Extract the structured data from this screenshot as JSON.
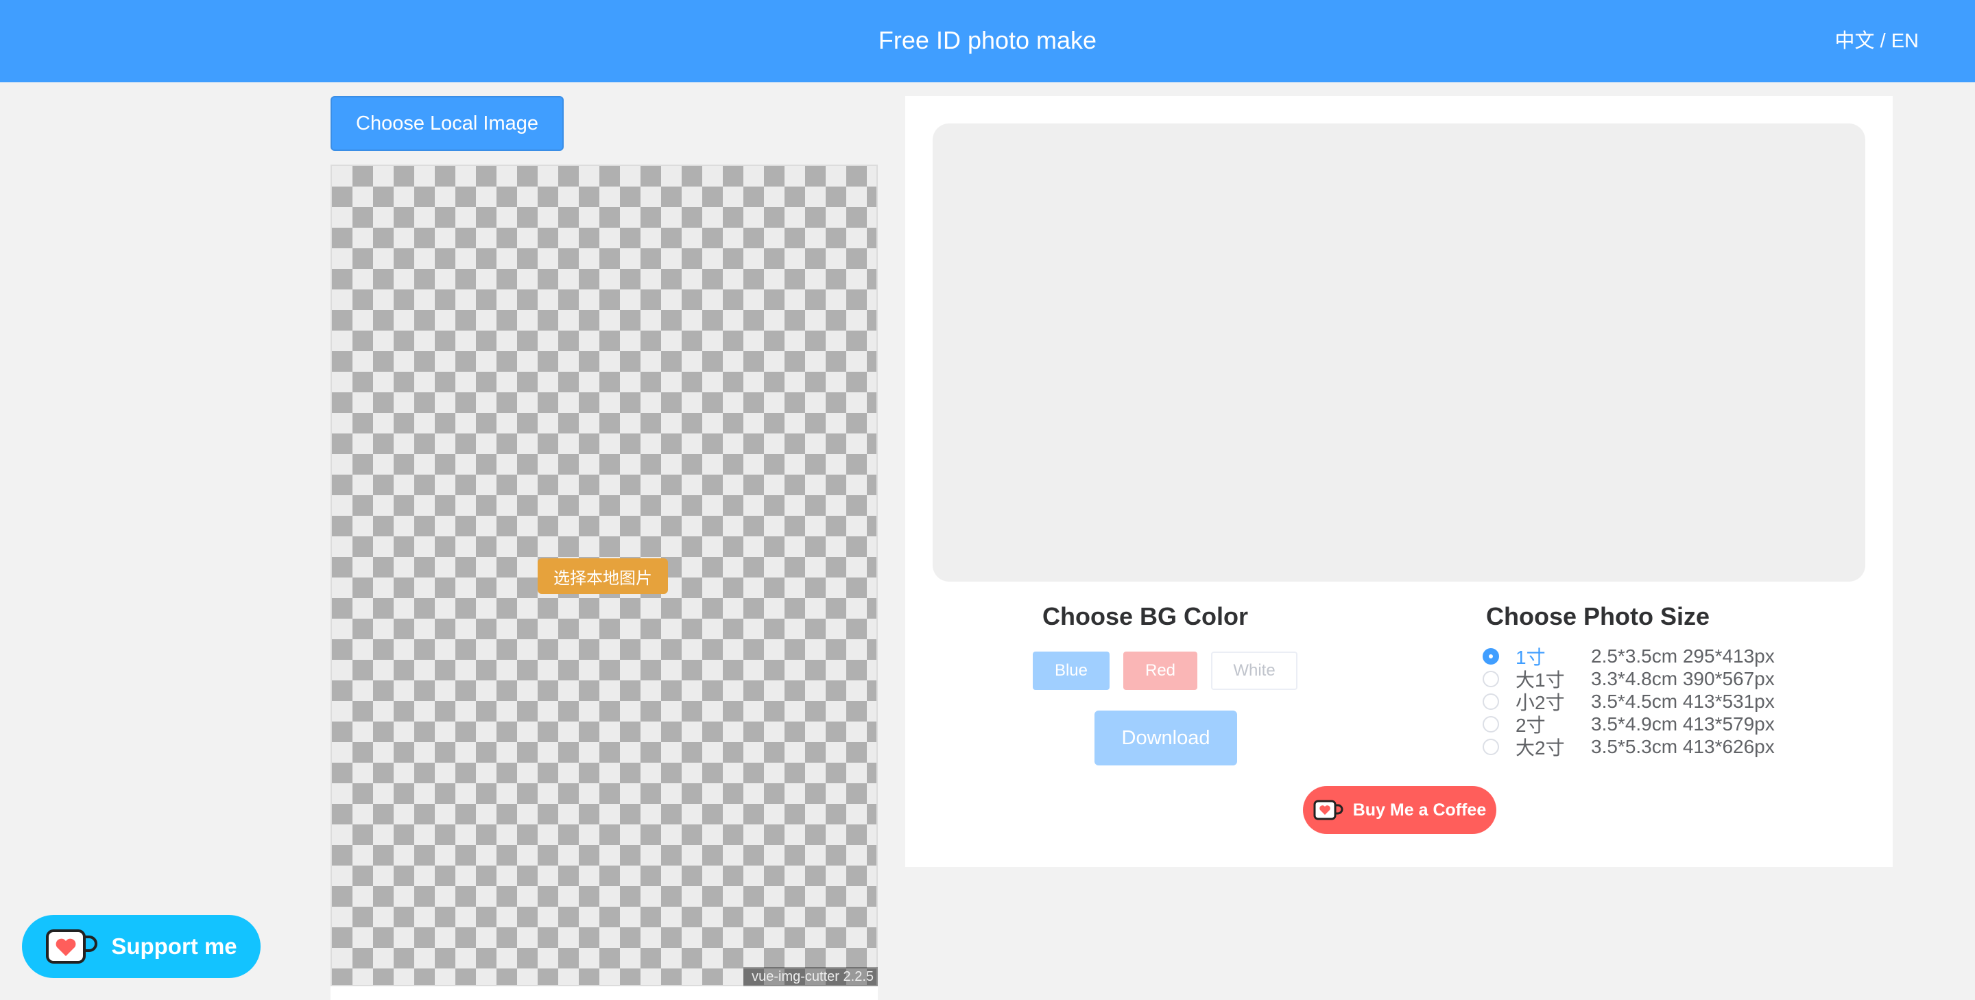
{
  "header": {
    "title": "Free ID photo make",
    "lang_switch": "中文 / EN"
  },
  "left": {
    "choose_button": "Choose Local Image",
    "cutter_select_button": "选择本地图片",
    "cutter_version": "vue-img-cutter 2.2.5"
  },
  "bg_color": {
    "title": "Choose BG Color",
    "options": [
      "Blue",
      "Red",
      "White"
    ],
    "download_label": "Download"
  },
  "photo_size": {
    "title": "Choose Photo Size",
    "selected": "1寸",
    "options": [
      {
        "name": "1寸",
        "spec": "2.5*3.5cm 295*413px"
      },
      {
        "name": "大1寸",
        "spec": "3.3*4.8cm 390*567px"
      },
      {
        "name": "小2寸",
        "spec": "3.5*4.5cm 413*531px"
      },
      {
        "name": "2寸",
        "spec": "3.5*4.9cm 413*579px"
      },
      {
        "name": "大2寸",
        "spec": "3.5*5.3cm 413*626px"
      }
    ]
  },
  "coffee_button": "Buy Me a Coffee",
  "support_button": "Support me",
  "colors": {
    "primary": "#409eff",
    "warning": "#e6a23c",
    "coffee": "#ff5e5b",
    "kofi": "#13c3ff"
  },
  "icons": [
    "kofi-cup-icon",
    "coffee-cup-icon"
  ]
}
